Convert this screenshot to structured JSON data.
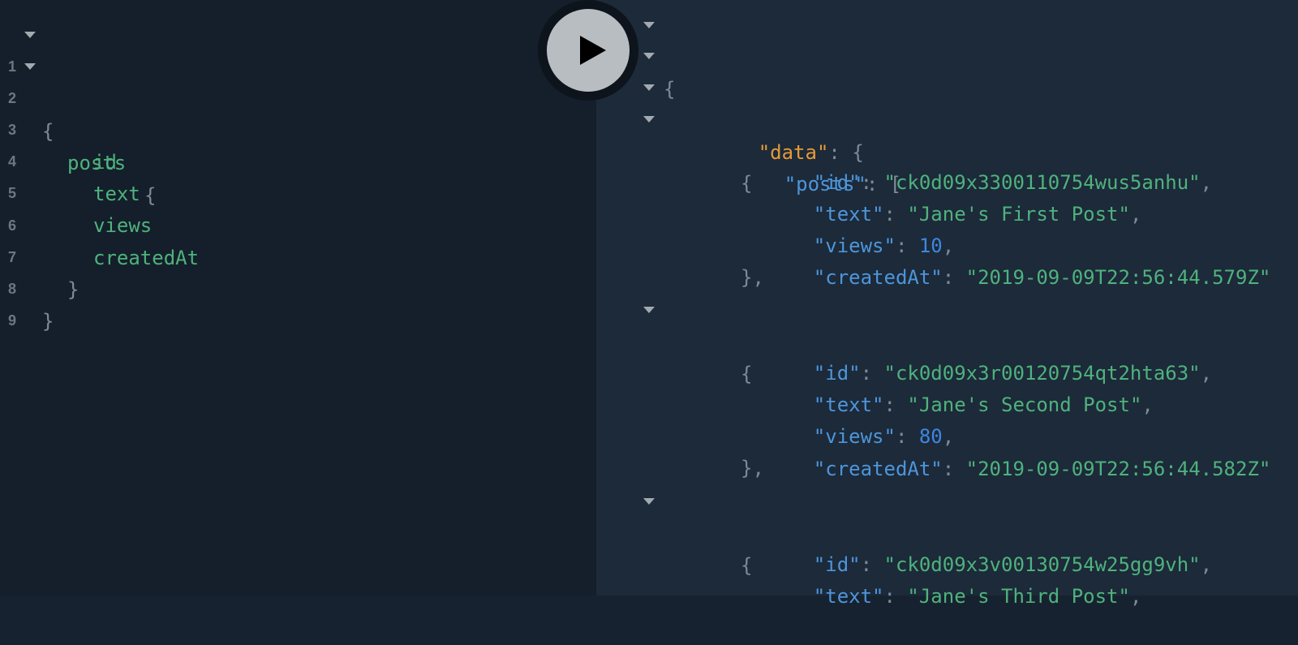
{
  "query_editor": {
    "lines": [
      {
        "num": "1",
        "text": "{",
        "foldable": true
      },
      {
        "num": "2",
        "text": "posts",
        "brace": "{",
        "foldable": true
      },
      {
        "num": "3",
        "text": "id"
      },
      {
        "num": "4",
        "text": "text"
      },
      {
        "num": "5",
        "text": "views"
      },
      {
        "num": "6",
        "text": "createdAt"
      },
      {
        "num": "7",
        "text": "}"
      },
      {
        "num": "8",
        "text": "}"
      },
      {
        "num": "9",
        "text": ""
      }
    ]
  },
  "run_button": {
    "icon": "play-icon"
  },
  "result": {
    "open_brace": "{",
    "data_key": "\"data\"",
    "posts_key": "\"posts\"",
    "colon": ": ",
    "brace_open": "{",
    "bracket_open": "[",
    "obj_close": "},",
    "comma": ",",
    "posts": [
      {
        "id_key": "\"id\"",
        "id": "\"ck0d09x3300110754wus5anhu\"",
        "text_key": "\"text\"",
        "text": "\"Jane's First Post\"",
        "views_key": "\"views\"",
        "views": "10",
        "createdAt_key": "\"createdAt\"",
        "createdAt": "\"2019-09-09T22:56:44.579Z\""
      },
      {
        "id_key": "\"id\"",
        "id": "\"ck0d09x3r00120754qt2hta63\"",
        "text_key": "\"text\"",
        "text": "\"Jane's Second Post\"",
        "views_key": "\"views\"",
        "views": "80",
        "createdAt_key": "\"createdAt\"",
        "createdAt": "\"2019-09-09T22:56:44.582Z\""
      },
      {
        "id_key": "\"id\"",
        "id": "\"ck0d09x3v00130754w25gg9vh\"",
        "text_key": "\"text\"",
        "text": "\"Jane's Third Post\""
      }
    ]
  }
}
